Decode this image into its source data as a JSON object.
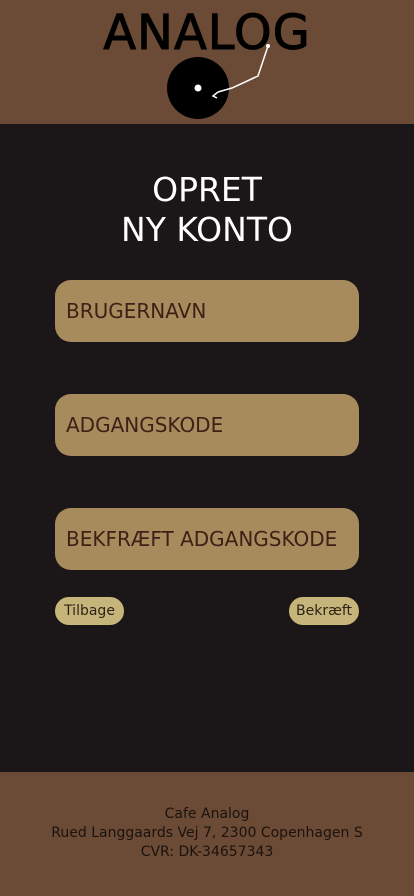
{
  "header": {
    "logo_text": "ANALOG",
    "logo_icon": "vinyl-record-icon"
  },
  "form": {
    "title_line1": "OPRET",
    "title_line2": "NY KONTO",
    "username_placeholder": "BRUGERNAVN",
    "password_placeholder": "ADGANGSKODE",
    "confirm_password_placeholder": "BEKFRÆFT ADGANGSKODE",
    "back_label": "Tilbage",
    "confirm_label": "Bekræft"
  },
  "footer": {
    "name": "Cafe Analog",
    "address": "Rued Langgaards Vej 7, 2300 Copenhagen S",
    "cvr": "CVR: DK-34657343"
  },
  "colors": {
    "header_bg": "#6c4b36",
    "main_bg": "#1b1617",
    "field_bg": "#a88b5d",
    "field_text": "#3d2117",
    "button_bg": "#c6b57b"
  }
}
